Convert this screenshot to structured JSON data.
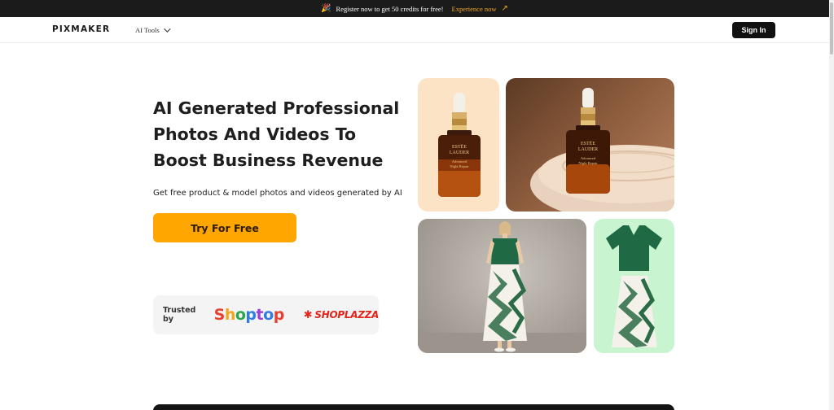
{
  "announcement": {
    "icon": "party-popper-icon",
    "text": "Register now to get 50 credits for free!",
    "cta": "Experience now",
    "arrow_icon": "arrow-up-right-icon",
    "cta_color": "#f5a623"
  },
  "nav": {
    "logo": "PIXMAKER",
    "menu_label": "AI Tools",
    "signin_label": "Sign In"
  },
  "hero": {
    "title": "AI Generated Professional Photos And Videos To Boost Business Revenue",
    "subtitle": "Get free product & model photos and videos generated by AI",
    "cta_label": "Try For Free",
    "cta_color": "#ffa600"
  },
  "trusted": {
    "label": "Trusted by",
    "brands": [
      "Shoptop",
      "SHOPLAZZA"
    ]
  },
  "gallery": {
    "tiles": [
      "serum-bottle-peach",
      "serum-bottle-dish",
      "model-dress",
      "dress-flatlay"
    ],
    "bottle_label": [
      "ESTEE",
      "LAUDER",
      "Advanced",
      "Night Repair"
    ]
  }
}
